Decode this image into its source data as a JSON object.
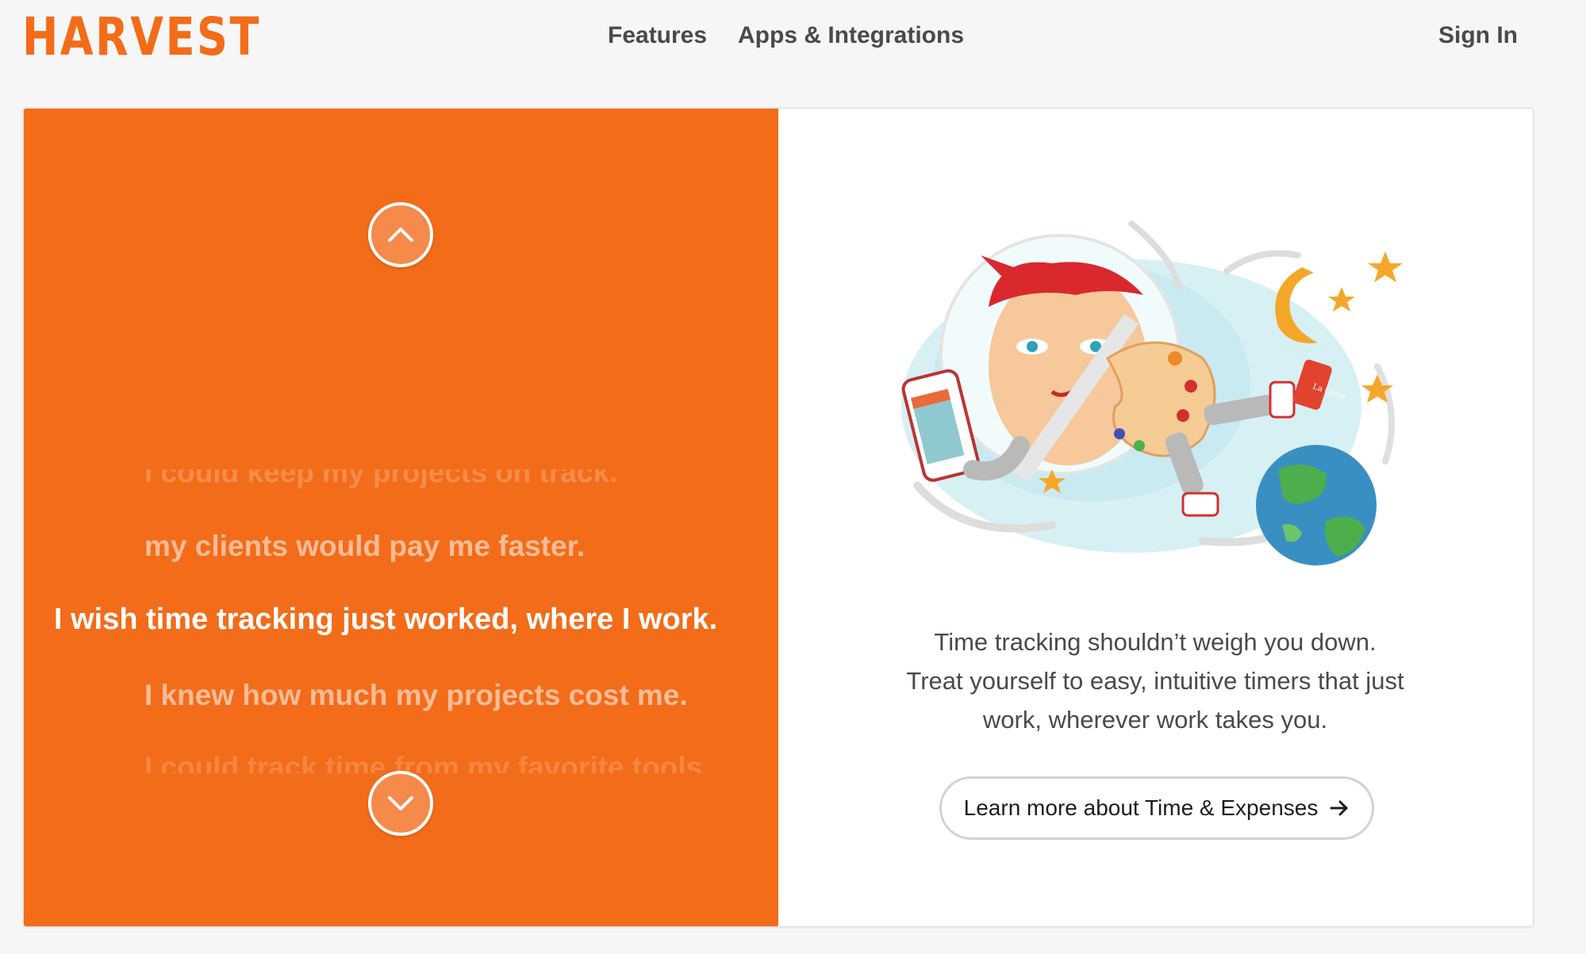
{
  "header": {
    "logo": "HARVEST",
    "nav": [
      "Features",
      "Apps & Integrations"
    ],
    "sign_in": "Sign In"
  },
  "hero": {
    "phrases": [
      "I could keep my projects on track.",
      "my clients would pay me faster.",
      "I wish time tracking just worked, where I work.",
      "I knew how much my projects cost me.",
      "I could track time from my favorite tools."
    ],
    "active_index": 2,
    "illustration_text": "La Croix",
    "description": [
      "Time tracking shouldn’t weigh you down.",
      "Treat yourself to easy, intuitive timers that just",
      "work, wherever work takes you."
    ],
    "cta_label": "Learn more about Time & Expenses"
  },
  "colors": {
    "brand_orange": "#f36c19",
    "background": "#f6f6f6",
    "text_dark": "#1d1e1c"
  },
  "icons": [
    "chevron-up-icon",
    "chevron-down-icon",
    "arrow-right-icon"
  ]
}
